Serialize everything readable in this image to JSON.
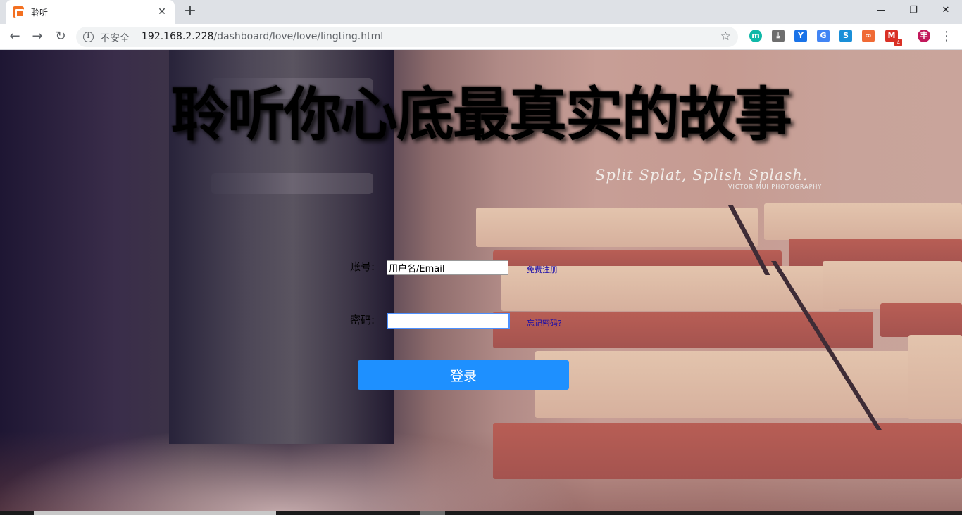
{
  "browser": {
    "tab_title": "聆听",
    "tab_close": "✕",
    "new_tab": "+",
    "window": {
      "minimize": "—",
      "restore": "❐",
      "close": "✕"
    },
    "nav": {
      "back": "←",
      "forward": "→",
      "reload": "↻"
    },
    "info_glyph": "i",
    "security_label": "不安全",
    "url_host": "192.168.2.228",
    "url_path": "/dashboard/love/love/lingting.html",
    "bookmark_glyph": "☆",
    "extensions": [
      {
        "name": "m-extension-icon",
        "glyph": "m",
        "color": "#10b8a8"
      },
      {
        "name": "download-extension-icon",
        "glyph": "⤓",
        "color": "#6e6e6e"
      },
      {
        "name": "y-extension-icon",
        "glyph": "Y",
        "color": "#1a73e8"
      },
      {
        "name": "translate-extension-icon",
        "glyph": "G",
        "color": "#4285f4"
      },
      {
        "name": "s-extension-icon",
        "glyph": "S",
        "color": "#1a8fd8"
      },
      {
        "name": "infinity-extension-icon",
        "glyph": "∞",
        "color": "#f06a35"
      },
      {
        "name": "mail-extension-icon",
        "glyph": "M",
        "color": "#d93025"
      }
    ],
    "mail_badge": "4",
    "profile_initial": "丰",
    "profile_color": "#c2185b",
    "menu_glyph": "⋮"
  },
  "page": {
    "title": "聆听你心底最真实的故事",
    "photo_caption": "Split Splat, Splish Splash.",
    "photo_credit": "VICTOR MUI PHOTOGRAPHY",
    "form": {
      "account_label": "账号:",
      "account_value": "用户名/Email",
      "register_link": "免费注册",
      "password_label": "密码:",
      "password_value": "",
      "forgot_link": "忘记密码?",
      "login_button": "登录"
    },
    "colors": {
      "login_button": "#1e90ff",
      "link": "#1a0dab"
    }
  }
}
